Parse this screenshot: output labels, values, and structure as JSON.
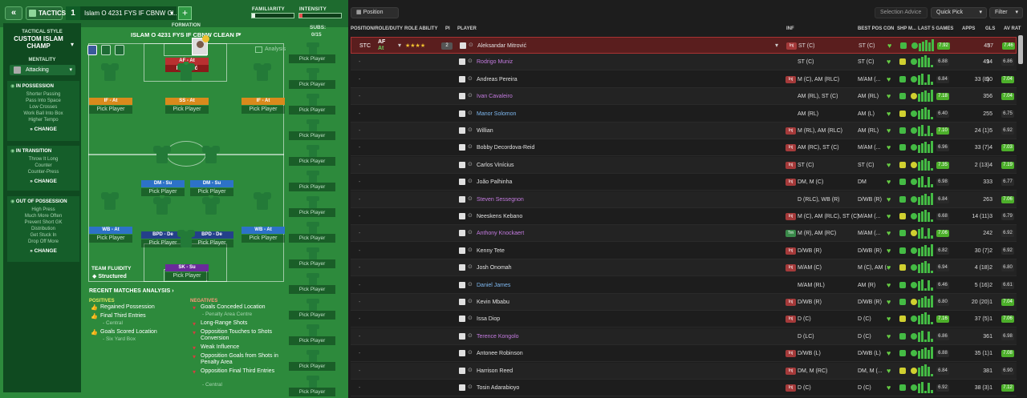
{
  "topbar": {
    "back": "«",
    "tactics_label": "TACTICS",
    "slot": "1",
    "tactic_name": "Islam O 4231 FYS IF CBNW Cl...",
    "add": "+",
    "familiarity_label": "FAMILIARITY",
    "familiarity_value": 0.07,
    "intensity_label": "INTENSITY",
    "intensity_value": 0.08
  },
  "side": {
    "style_label": "TACTICAL STYLE",
    "style_name": "CUSTOM ISLAM CHAMP",
    "mentality_label": "MENTALITY",
    "mentality_value": "Attacking",
    "possession_title": "IN POSSESSION",
    "possession_items": [
      "Shorter Passing",
      "Pass Into Space",
      "Low Crosses",
      "Work Ball Into Box",
      "Higher Tempo"
    ],
    "transition_title": "IN TRANSITION",
    "transition_items": [
      "Throw It Long",
      "Counter",
      "Counter-Press"
    ],
    "oop_title": "OUT OF POSSESSION",
    "oop_items": [
      "High Press",
      "Much More Often",
      "Prevent Short GK",
      "Distribution",
      "Get Stuck In",
      "Drop Off More"
    ],
    "change": "CHANGE"
  },
  "pitch": {
    "formation_label": "FORMATION",
    "formation_name": "ISLAM O 4231 FYS IF CBNW CLEAN P",
    "subs_label": "SUBS:",
    "subs_count": "0/15",
    "analysis": "Analysis",
    "fluidity_label": "TEAM FLUIDITY",
    "fluidity_value": "Structured",
    "pick": "Pick Player",
    "striker_role": "AF - At",
    "striker_name": "Mitrović",
    "roles": {
      "if_l": "IF - At",
      "ss": "SS - At",
      "if_r": "IF - At",
      "dm_l": "DM - Su",
      "dm_r": "DM - Su",
      "wb_l": "WB - At",
      "bpd_l": "BPD - De",
      "bpd_r": "BPD - De",
      "wb_r": "WB - At",
      "sk": "SK - Su"
    }
  },
  "analysis": {
    "title": "RECENT MATCHES ANALYSIS ›",
    "pos_label": "POSITIVES",
    "neg_label": "NEGATIVES",
    "positives": [
      {
        "t": "Regained Possession",
        "s": ""
      },
      {
        "t": "Final Third Entries",
        "s": "- Central"
      },
      {
        "t": "Goals Scored Location",
        "s": "- Six Yard Box"
      }
    ],
    "negatives": [
      {
        "t": "Goals Conceded Location",
        "s": "- Penalty Area Centre"
      },
      {
        "t": "Long-Range Shots",
        "s": ""
      },
      {
        "t": "Opposition Touches to Shots Conversion",
        "s": ""
      },
      {
        "t": "Weak Influence",
        "s": ""
      },
      {
        "t": "Opposition Goals from Shots in Penalty Area",
        "s": ""
      },
      {
        "t": "Opposition Final Third Entries",
        "s": "- Central"
      }
    ]
  },
  "right": {
    "position_dd": "Position",
    "selection_advice": "Selection Advice",
    "quick_pick": "Quick Pick",
    "filter": "Filter",
    "headers": {
      "pos": "POSITION/ROLE/DUTY",
      "ability": "ROLE ABILITY",
      "pi": "PI",
      "player": "PLAYER",
      "inf": "INF",
      "best": "BEST POS",
      "con": "CON",
      "shp": "SHP",
      "mor": "M...",
      "last5": "LAST 5 GAMES",
      "apps": "APPS",
      "gls": "GLS",
      "avrat": "AV RAT"
    },
    "selected": {
      "pos": "STC",
      "role": "AF",
      "duty": "At",
      "stars": "★★★★",
      "stars_empty": "☆",
      "pi": "2"
    },
    "players": [
      {
        "name": "Aleksandar Mitrović",
        "inf": "Inj",
        "pos": "ST (C)",
        "best": "ST (C)",
        "form": "7.92",
        "apps": "45",
        "gls": "37",
        "av": "7.46",
        "c": "n"
      },
      {
        "name": "Rodrigo Muniz",
        "inf": "",
        "pos": "ST (C)",
        "best": "ST (C)",
        "form": "6.88",
        "apps": "49",
        "gls": "14",
        "av": "6.86",
        "c": "loan"
      },
      {
        "name": "Andreas Pereira",
        "inf": "Inj",
        "pos": "M (C), AM (RLC)",
        "best": "M/AM (...",
        "form": "6.84",
        "apps": "33 (8)",
        "gls": "10",
        "av": "7.04",
        "c": "n"
      },
      {
        "name": "Ivan Cavaleiro",
        "inf": "",
        "pos": "AM (RL), ST (C)",
        "best": "AM (RL)",
        "form": "7.18",
        "apps": "35",
        "gls": "6",
        "av": "7.04",
        "c": "loan"
      },
      {
        "name": "Manor Solomon",
        "inf": "",
        "pos": "AM (RL)",
        "best": "AM (L)",
        "form": "6.40",
        "apps": "25",
        "gls": "5",
        "av": "6.75",
        "c": "blue"
      },
      {
        "name": "Willian",
        "inf": "Inj",
        "pos": "M (RL), AM (RLC)",
        "best": "AM (RL)",
        "form": "7.10",
        "apps": "24 (1)",
        "gls": "5",
        "av": "6.92",
        "c": "n"
      },
      {
        "name": "Bobby Decordova-Reid",
        "inf": "Inj",
        "pos": "AM (RC), ST (C)",
        "best": "M/AM (...",
        "form": "6.96",
        "apps": "33 (7)",
        "gls": "4",
        "av": "7.03",
        "c": "n"
      },
      {
        "name": "Carlos Vinícius",
        "inf": "Inj",
        "pos": "ST (C)",
        "best": "ST (C)",
        "form": "7.35",
        "apps": "2 (13)",
        "gls": "4",
        "av": "7.19",
        "c": "n"
      },
      {
        "name": "João Palhinha",
        "inf": "Inj",
        "pos": "DM, M (C)",
        "best": "DM",
        "form": "6.98",
        "apps": "33",
        "gls": "3",
        "av": "6.77",
        "c": "n"
      },
      {
        "name": "Steven Sessegnon",
        "inf": "",
        "pos": "D (RLC), WB (R)",
        "best": "D/WB (R)",
        "form": "6.84",
        "apps": "26",
        "gls": "3",
        "av": "7.06",
        "c": "loan"
      },
      {
        "name": "Neeskens Kebano",
        "inf": "Inj",
        "pos": "M (C), AM (RLC), ST (C)",
        "best": "M/AM (...",
        "form": "6.68",
        "apps": "14 (11)",
        "gls": "3",
        "av": "6.79",
        "c": "n"
      },
      {
        "name": "Anthony Knockaert",
        "inf": "Trn",
        "pos": "M (R), AM (RC)",
        "best": "M/AM (...",
        "form": "7.06",
        "apps": "24",
        "gls": "2",
        "av": "6.92",
        "c": "loan"
      },
      {
        "name": "Kenny Tete",
        "inf": "Inj",
        "pos": "D/WB (R)",
        "best": "D/WB (R)",
        "form": "6.82",
        "apps": "30 (7)",
        "gls": "2",
        "av": "6.92",
        "c": "n"
      },
      {
        "name": "Josh Onomah",
        "inf": "Inj",
        "pos": "M/AM (C)",
        "best": "M (C), AM (...",
        "form": "6.94",
        "apps": "4 (18)",
        "gls": "2",
        "av": "6.80",
        "c": "n"
      },
      {
        "name": "Daniel James",
        "inf": "",
        "pos": "M/AM (RL)",
        "best": "AM (R)",
        "form": "6.46",
        "apps": "5 (16)",
        "gls": "2",
        "av": "6.61",
        "c": "blue"
      },
      {
        "name": "Kevin Mbabu",
        "inf": "Inj",
        "pos": "D/WB (R)",
        "best": "D/WB (R)",
        "form": "6.80",
        "apps": "20 (20)",
        "gls": "1",
        "av": "7.04",
        "c": "n"
      },
      {
        "name": "Issa Diop",
        "inf": "Inj",
        "pos": "D (C)",
        "best": "D (C)",
        "form": "7.16",
        "apps": "37 (5)",
        "gls": "1",
        "av": "7.06",
        "c": "n"
      },
      {
        "name": "Terence Kongolo",
        "inf": "",
        "pos": "D (LC)",
        "best": "D (C)",
        "form": "6.86",
        "apps": "36",
        "gls": "1",
        "av": "6.98",
        "c": "loan"
      },
      {
        "name": "Antonee Robinson",
        "inf": "Inj",
        "pos": "D/WB (L)",
        "best": "D/WB (L)",
        "form": "6.88",
        "apps": "35 (1)",
        "gls": "1",
        "av": "7.08",
        "c": "n"
      },
      {
        "name": "Harrison Reed",
        "inf": "Inj",
        "pos": "DM, M (RC)",
        "best": "DM, M (...",
        "form": "6.84",
        "apps": "38",
        "gls": "1",
        "av": "6.90",
        "c": "n"
      },
      {
        "name": "Tosin Adarabioyo",
        "inf": "Inj",
        "pos": "D (C)",
        "best": "D (C)",
        "form": "6.92",
        "apps": "38 (3)",
        "gls": "1",
        "av": "7.12",
        "c": "n"
      }
    ]
  },
  "colors": {
    "pitch": "#2d8a3c",
    "sidebar": "#0f4a20",
    "selected_row": "#5a1e1e",
    "form_green": "#44bb44"
  }
}
